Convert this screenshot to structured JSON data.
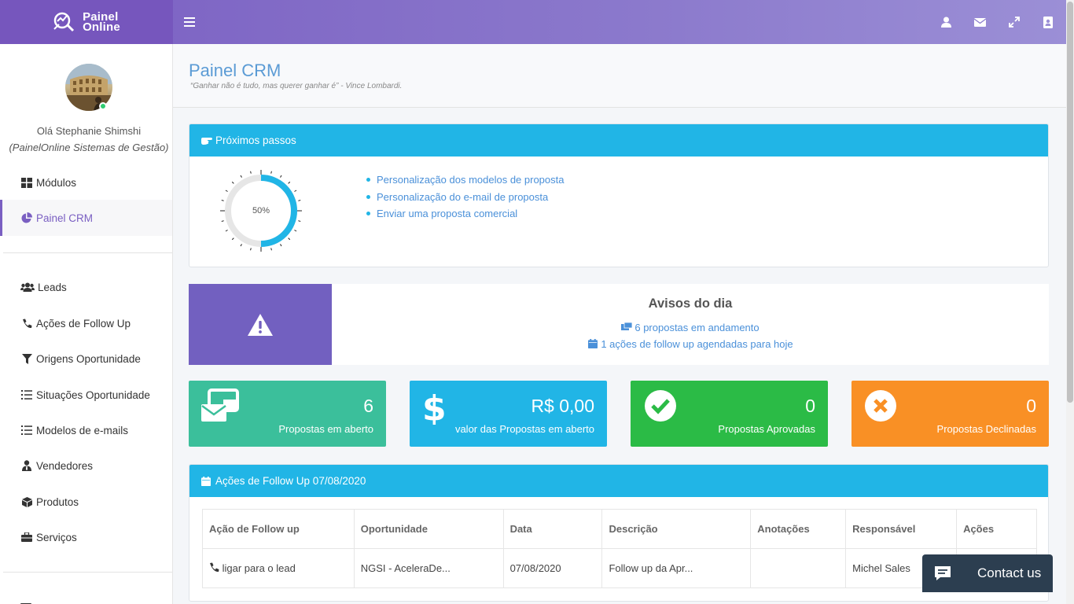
{
  "brand": {
    "line1": "Painel",
    "line2": "Online"
  },
  "user": {
    "hello": "Olá Stephanie Shimshi",
    "company": "(PainelOnline Sistemas de Gestão)"
  },
  "sidebar": {
    "items": [
      {
        "label": "Módulos",
        "icon": "grid-icon"
      },
      {
        "label": "Painel CRM",
        "icon": "pie-chart-icon",
        "active": true
      },
      {
        "label": "Leads",
        "icon": "users-icon"
      },
      {
        "label": "Ações de Follow Up",
        "icon": "phone-icon"
      },
      {
        "label": "Origens Oportunidade",
        "icon": "filter-icon"
      },
      {
        "label": "Situações Oportunidade",
        "icon": "list-icon"
      },
      {
        "label": "Modelos de e-mails",
        "icon": "list-icon"
      },
      {
        "label": "Vendedores",
        "icon": "user-tie-icon"
      },
      {
        "label": "Produtos",
        "icon": "box-icon"
      },
      {
        "label": "Serviços",
        "icon": "briefcase-icon"
      }
    ]
  },
  "page": {
    "title": "Painel CRM",
    "quote": "“Ganhar não é tudo, mas querer ganhar é” - Vince Lombardi."
  },
  "next_steps": {
    "title": "Próximos passos",
    "progress_label": "50%",
    "progress": 0.5,
    "items": [
      "Personalização dos modelos de proposta",
      "Personalização do e-mail de proposta",
      "Enviar uma proposta comercial"
    ]
  },
  "avisos": {
    "title": "Avisos do dia",
    "line1": "6 propostas em andamento",
    "line2": "1 ações de follow up agendadas para hoje"
  },
  "stats": [
    {
      "value": "6",
      "label": "Propostas em aberto",
      "color": "#3bbf9b",
      "icon": "envelopes-icon"
    },
    {
      "value": "R$ 0,00",
      "label": "valor das Propostas em aberto",
      "color": "#21b5e6",
      "icon": "dollar-icon"
    },
    {
      "value": "0",
      "label": "Propostas Aprovadas",
      "color": "#2bbb46",
      "icon": "check-circle-icon"
    },
    {
      "value": "0",
      "label": "Propostas Declinadas",
      "color": "#f99025",
      "icon": "times-circle-icon"
    }
  ],
  "followup": {
    "title": "Ações de Follow Up 07/08/2020",
    "columns": [
      "Ação de Follow up",
      "Oportunidade",
      "Data",
      "Descrição",
      "Anotações",
      "Responsável",
      "Ações"
    ],
    "rows": [
      [
        "ligar para o lead",
        "NGSI - AceleraDe...",
        "07/08/2020",
        "Follow up da Apr...",
        "",
        "Michel Sales",
        ""
      ]
    ]
  },
  "contact": {
    "label": "Contact us"
  },
  "colors": {
    "brand": "#7a5fc2",
    "header_blue": "#21b5e6",
    "link": "#4a90d9",
    "alert_box": "#7260c0"
  }
}
